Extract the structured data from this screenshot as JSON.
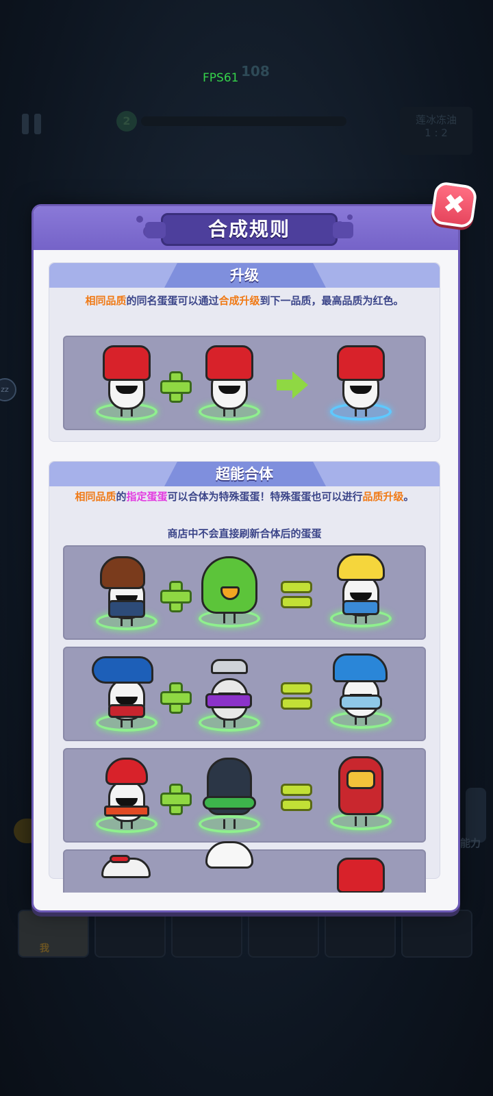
{
  "hud": {
    "fps": "FPS61",
    "score": "108",
    "wave_number": "2",
    "mode_label": "莲冰冻油",
    "mode_sub": "1 : 2",
    "bubble": "zz",
    "slot_label": "我",
    "right_label": "能力"
  },
  "dialog": {
    "title": "合成规则",
    "close_label": "✖"
  },
  "upgrade": {
    "title": "升级",
    "desc_part1": "相同品质",
    "desc_part2": "的同名蛋蛋可以通过",
    "desc_part3": "合成升级",
    "desc_part4": "到下一品质，最高品质为红色。",
    "example": {
      "left": "red-haired-egg",
      "right": "red-haired-egg",
      "result": "red-haired-egg-upgraded"
    }
  },
  "fusion": {
    "title": "超能合体",
    "desc_part1": "相同品质",
    "desc_part2": "的",
    "desc_part3": "指定蛋蛋",
    "desc_part4": "可以合体为特殊蛋蛋！特殊蛋蛋也可以进行",
    "desc_part5": "品质升级",
    "desc_part6": "。",
    "desc_line3": "商店中不会直接刷新合体后的蛋蛋",
    "recipes": [
      {
        "a": "brown-hair-jacket-egg",
        "b": "green-leaf-bird-egg",
        "result": "blonde-horn-egg"
      },
      {
        "a": "blue-ponytail-egg",
        "b": "purple-ninja-egg",
        "result": "blue-spiky-hair-egg"
      },
      {
        "a": "red-boxer-egg",
        "b": "dark-hooded-egg",
        "result": "red-iron-armor-egg"
      },
      {
        "a": "white-cap-egg",
        "b": "chef-hat-egg",
        "result": "red-haired-egg"
      }
    ]
  },
  "colors": {
    "dialog_header": "#7563c8",
    "section_header": "#a6b1ea",
    "highlight_orange": "#f07a16",
    "highlight_pink": "#e33be0",
    "text_blue": "#3b4589",
    "close_button": "#e6455d"
  }
}
